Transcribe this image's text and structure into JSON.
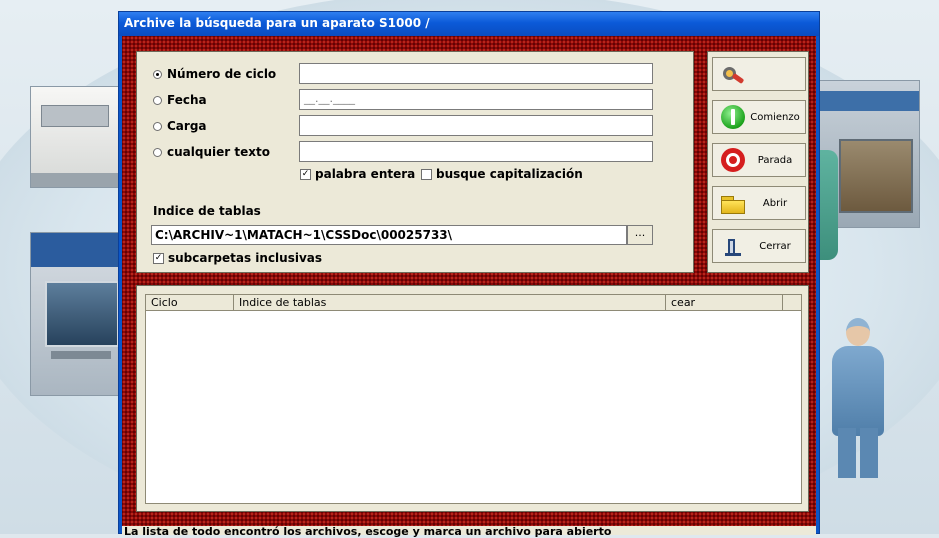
{
  "window": {
    "title": "Archive la búsqueda para un aparato  S1000 /"
  },
  "search": {
    "options": [
      {
        "label": "Número de ciclo",
        "selected": true
      },
      {
        "label": "Fecha",
        "selected": false
      },
      {
        "label": "Carga",
        "selected": false
      },
      {
        "label": "cualquier texto",
        "selected": false
      }
    ],
    "date_placeholder": "__.__.____",
    "whole_word": {
      "label": "palabra entera",
      "checked": true
    },
    "match_case": {
      "label": "busque capitalización",
      "checked": false
    },
    "index_label": "Indice de tablas",
    "index_path": "C:\\ARCHIV~1\\MATACH~1\\CSSDoc\\00025733\\",
    "browse_label": "...",
    "subfolders": {
      "label": "subcarpetas inclusivas",
      "checked": true
    }
  },
  "buttons": {
    "find": {
      "label": "",
      "icon": "find-icon"
    },
    "start": {
      "label": "Comienzo",
      "icon": "start-icon"
    },
    "stop": {
      "label": "Parada",
      "icon": "stop-icon"
    },
    "open": {
      "label": "Abrir",
      "icon": "folder-open-icon"
    },
    "close": {
      "label": "Cerrar",
      "icon": "exit-door-icon"
    }
  },
  "results": {
    "columns": [
      "Ciclo",
      "Indice de tablas",
      "cear",
      ""
    ],
    "rows": []
  },
  "status": {
    "text": "La lista de todo encontró los archivos, escoge y marca un archivo para abierto"
  },
  "colors": {
    "titlebar": "#0b5ad8",
    "frame": "#8c0707",
    "panel": "#ece9d8"
  }
}
